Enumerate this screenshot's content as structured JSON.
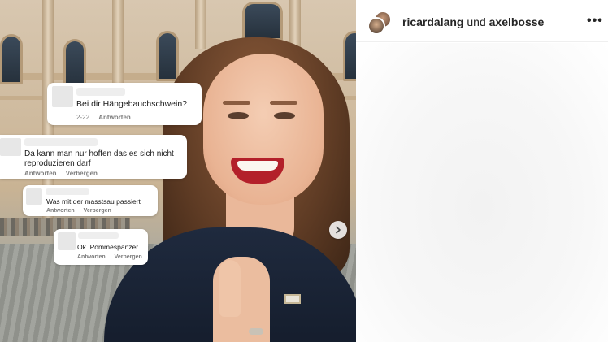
{
  "header": {
    "user1": "ricardalang",
    "connector": "und",
    "user2": "axelbosse",
    "more_icon": "more-horizontal-icon"
  },
  "comments": [
    {
      "text": "Bei dir Hängebauchschwein?",
      "date": "2-22",
      "reply": "Antworten"
    },
    {
      "text": "Da kann man nur hoffen das es sich nicht reproduzieren darf",
      "reply": "Antworten",
      "hide": "Verbergen"
    },
    {
      "text": "Was mit der masstsau passiert",
      "reply": "Antworten",
      "hide": "Verbergen"
    },
    {
      "text": "Ok. Pommespanzer.",
      "reply": "Antworten",
      "hide": "Verbergen"
    }
  ],
  "carousel": {
    "next_icon": "chevron-right-icon"
  }
}
